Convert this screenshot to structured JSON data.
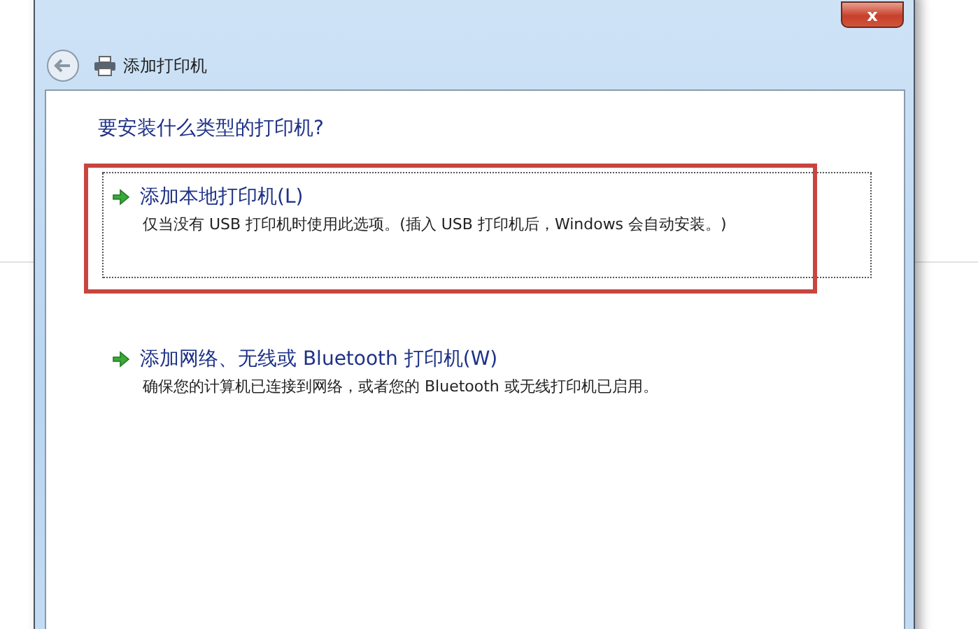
{
  "window": {
    "title": "添加打印机",
    "close_label": "x"
  },
  "heading": "要安装什么类型的打印机?",
  "options": [
    {
      "label": "添加本地打印机(L)",
      "description": "仅当没有 USB 打印机时使用此选项。(插入 USB 打印机后，Windows 会自动安装。)",
      "selected": true
    },
    {
      "label": "添加网络、无线或 Bluetooth 打印机(W)",
      "description": "确保您的计算机已连接到网络，或者您的 Bluetooth 或无线打印机已启用。",
      "selected": false
    }
  ]
}
